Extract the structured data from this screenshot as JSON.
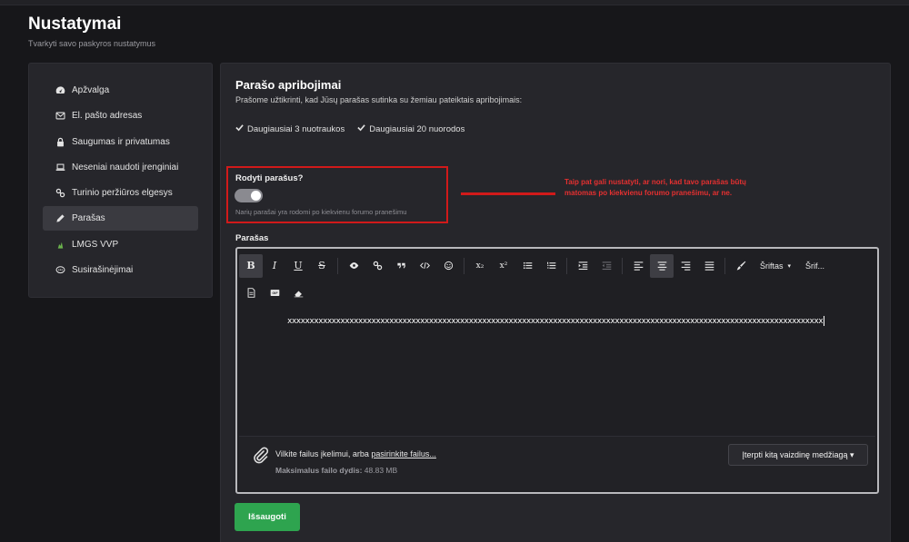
{
  "header": {
    "title": "Nustatymai",
    "subtitle": "Tvarkyti savo paskyros nustatymus"
  },
  "sidebar": {
    "items": [
      {
        "label": "Apžvalga",
        "icon": "dashboard-icon",
        "active": false
      },
      {
        "label": "El. pašto adresas",
        "icon": "envelope-icon",
        "active": false
      },
      {
        "label": "Saugumas ir privatumas",
        "icon": "lock-icon",
        "active": false
      },
      {
        "label": "Neseniai naudoti įrenginiai",
        "icon": "laptop-icon",
        "active": false
      },
      {
        "label": "Turinio peržiūros elgesys",
        "icon": "link-icon",
        "active": false
      },
      {
        "label": "Parašas",
        "icon": "pencil-icon",
        "active": true
      },
      {
        "label": "LMGS VVP",
        "icon": "tree-icon",
        "active": false
      },
      {
        "label": "Susirašinėjimai",
        "icon": "chat-icon",
        "active": false
      }
    ]
  },
  "main": {
    "section_title": "Parašo apribojimai",
    "section_desc": "Prašome užtikrinti, kad Jūsų parašas sutinka su žemiau pateiktais apribojimais:",
    "limits": [
      "Daugiausiai 3 nuotraukos",
      "Daugiausiai 20 nuorodos"
    ],
    "toggle": {
      "label": "Rodyti parašus?",
      "hint": "Narių parašai yra rodomi po kiekvienu forumo pranešimu",
      "checked": true
    },
    "annotation": "Taip pat gali nustatyti, ar nori, kad tavo parašas būtų matomas po kiekvienu forumo pranešimu, ar ne.",
    "editor": {
      "label": "Parašas",
      "toolbar": {
        "bold": "B",
        "italic": "I",
        "underline": "U",
        "strike": "S",
        "subscript": "x₂",
        "superscript": "x²",
        "font_label": "Šriftas",
        "font_size_label": "Šrif..."
      },
      "content": "xxxxxxxxxxxxxxxxxxxxxxxxxxxxxxxxxxxxxxxxxxxxxxxxxxxxxxxxxxxxxxxxxxxxxxxxxxxxxxxxxxxxxxxxxxxxxxxxxxxxxxxxxxxxxxxxxxxxxxxxx",
      "attach_text": "Vilkite failus įkelimui, arba ",
      "attach_link": "pasirinkite failus...",
      "max_size_label": "Maksimalus failo dydis:",
      "max_size_value": "48.83 MB",
      "insert_button": "Įterpti kitą vaizdinę medžiagą ▾"
    },
    "save_button": "Išsaugoti"
  },
  "colors": {
    "background": "#17171a",
    "panel": "#26262b",
    "accent_green": "#2ea44f",
    "annotation_red": "#d11a1a"
  }
}
